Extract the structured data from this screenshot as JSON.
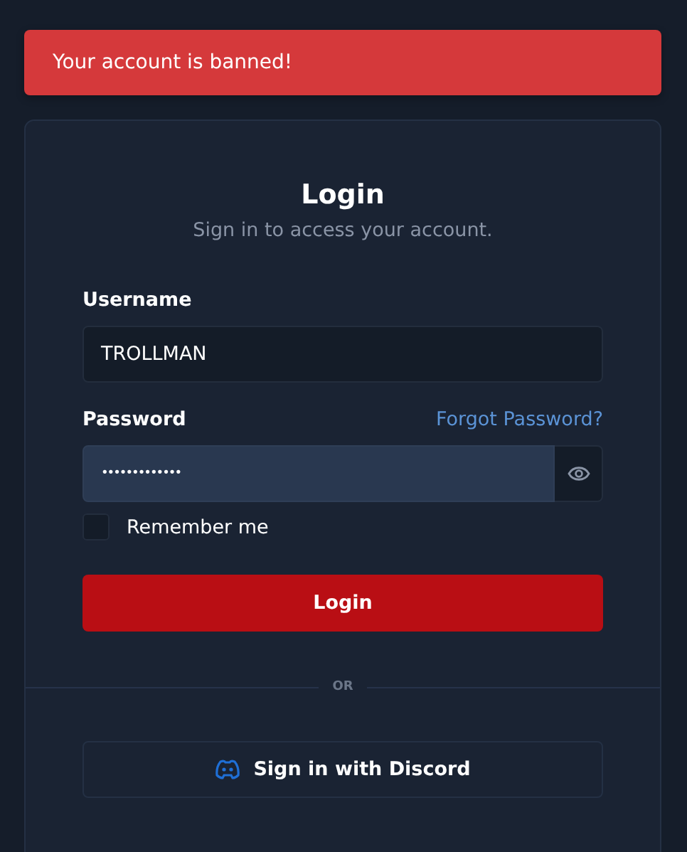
{
  "alert": {
    "message": "Your account is banned!"
  },
  "login": {
    "title": "Login",
    "subtitle": "Sign in to access your account.",
    "username": {
      "label": "Username",
      "value": "TROLLMAN"
    },
    "password": {
      "label": "Password",
      "forgot_link": "Forgot Password?",
      "value": "•••••••••••••"
    },
    "remember": {
      "label": "Remember me",
      "checked": false
    },
    "submit": "Login",
    "divider": "OR",
    "discord_button": "Sign in with Discord"
  }
}
